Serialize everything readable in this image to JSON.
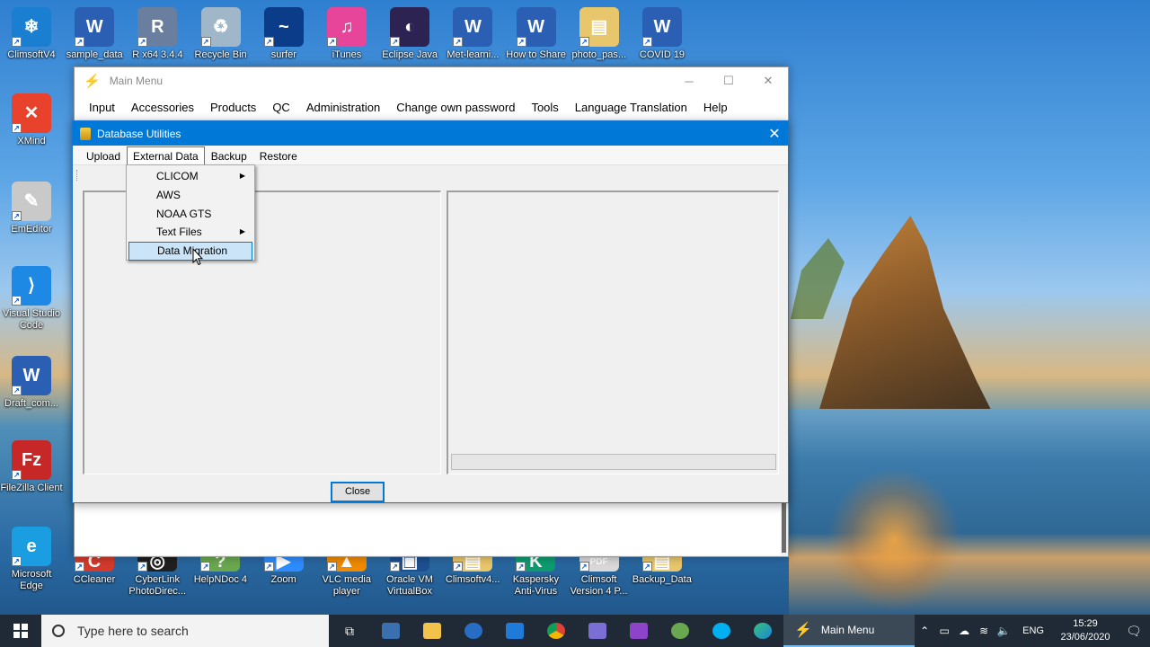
{
  "desktop": {
    "icons_top": [
      {
        "label": "ClimsoftV4",
        "color": "#1a7fd0",
        "glyph": "❄"
      },
      {
        "label": "sample_data",
        "color": "#2b5fb4",
        "glyph": "W"
      },
      {
        "label": "R x64 3.4.4",
        "color": "#6a7fa0",
        "glyph": "R"
      },
      {
        "label": "Recycle Bin",
        "color": "#9fb7c9",
        "glyph": "♻"
      },
      {
        "label": "surfer",
        "color": "#0b3c8a",
        "glyph": "~"
      },
      {
        "label": "iTunes",
        "color": "#e6459a",
        "glyph": "♫"
      },
      {
        "label": "Eclipse Java",
        "color": "#2c2352",
        "glyph": "◐"
      },
      {
        "label": "Met-learni...",
        "color": "#2b5fb4",
        "glyph": "W"
      },
      {
        "label": "How to Share",
        "color": "#2b5fb4",
        "glyph": "W"
      },
      {
        "label": "photo_pas...",
        "color": "#e8c66b",
        "glyph": "▤"
      },
      {
        "label": "COVID 19",
        "color": "#2b5fb4",
        "glyph": "W"
      }
    ],
    "icons_left": [
      {
        "label": "XMind",
        "color": "#e8412c",
        "glyph": "✕"
      },
      {
        "label": "EmEditor",
        "color": "#c9c9c9",
        "glyph": "✎"
      },
      {
        "label": "Visual Studio Code",
        "color": "#1e88e5",
        "glyph": "⟩"
      },
      {
        "label": "Draft_com...",
        "color": "#2b5fb4",
        "glyph": "W"
      },
      {
        "label": "FileZilla Client",
        "color": "#c62828",
        "glyph": "Fz"
      },
      {
        "label": "Microsoft Edge",
        "color": "#1b9de2",
        "glyph": "e"
      }
    ],
    "icons_bottom": [
      {
        "label": "CCleaner",
        "color": "#d33a2c",
        "glyph": "C"
      },
      {
        "label": "CyberLink PhotoDirec...",
        "color": "#1f1f1f",
        "glyph": "◎"
      },
      {
        "label": "HelpNDoc 4",
        "color": "#6aa84f",
        "glyph": "?"
      },
      {
        "label": "Zoom",
        "color": "#2d8cff",
        "glyph": "▶"
      },
      {
        "label": "VLC media player",
        "color": "#f08a00",
        "glyph": "▲"
      },
      {
        "label": "Oracle VM VirtualBox",
        "color": "#1d4f91",
        "glyph": "▣"
      },
      {
        "label": "Climsoftv4...",
        "color": "#e8c66b",
        "glyph": "▤"
      },
      {
        "label": "Kaspersky Anti-Virus",
        "color": "#0c9b6f",
        "glyph": "K"
      },
      {
        "label": "Climsoft Version 4 P...",
        "color": "#d9d9d9",
        "glyph": "PDF"
      },
      {
        "label": "Backup_Data",
        "color": "#e8c66b",
        "glyph": "▤"
      }
    ]
  },
  "main_window": {
    "title": "Main Menu",
    "menu": [
      "Input",
      "Accessories",
      "Products",
      "QC",
      "Administration",
      "Change own password",
      "Tools",
      "Language Translation",
      "Help"
    ]
  },
  "dialog": {
    "title": "Database Utilities",
    "menu": [
      "Upload",
      "External Data",
      "Backup",
      "Restore"
    ],
    "close_label": "Close"
  },
  "dropdown": {
    "items": [
      {
        "label": "CLICOM",
        "submenu": true
      },
      {
        "label": "AWS",
        "submenu": false
      },
      {
        "label": "NOAA GTS",
        "submenu": false
      },
      {
        "label": "Text Files",
        "submenu": true
      },
      {
        "label": "Data Migration",
        "submenu": false,
        "highlighted": true
      }
    ]
  },
  "taskbar": {
    "search_placeholder": "Type here to search",
    "active_app": "Main Menu",
    "language": "ENG",
    "time": "15:29",
    "date": "23/06/2020"
  }
}
